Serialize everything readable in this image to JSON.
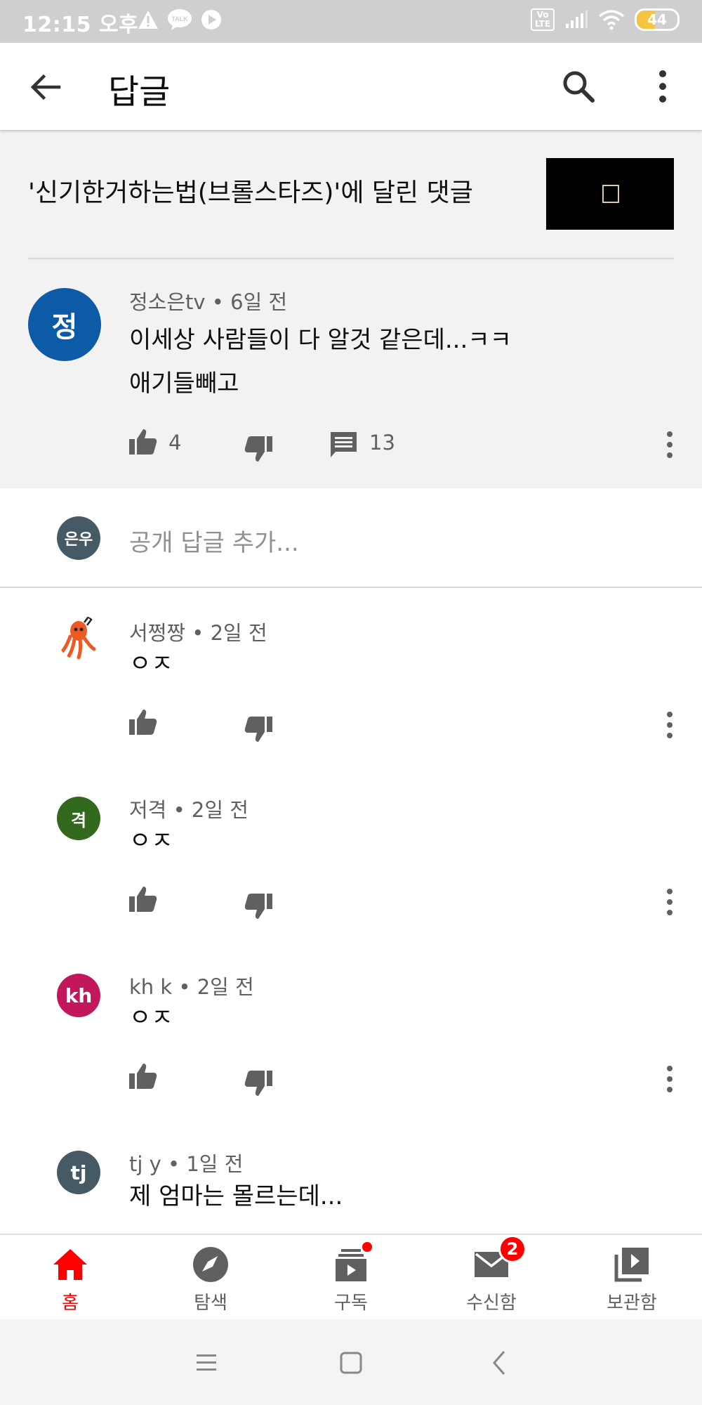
{
  "status_bar": {
    "time": "12:15 오후",
    "battery": "44",
    "battery_level": 0.44,
    "volte_label": "Vo LTE",
    "talk_label": "TALK"
  },
  "app_bar": {
    "title": "답글"
  },
  "video": {
    "title": "'신기한거하는법(브롤스타즈)'에 달린 댓글"
  },
  "parent_comment": {
    "avatar_letter": "정",
    "avatar_color": "#0d5aa7",
    "author": "정소은tv",
    "time": "6일 전",
    "text_line1": "이세상 사람들이 다 알것 같은데...ㅋㅋ",
    "text_line2": "애기들빼고",
    "likes": "4",
    "replies": "13"
  },
  "reply_box": {
    "avatar_letter": "은우",
    "avatar_color": "#455a64",
    "placeholder": "공개 답글 추가..."
  },
  "replies": [
    {
      "author": "서쩡짱",
      "time": "2일 전",
      "text": "ㅇㅈ",
      "avatar_letter": "",
      "avatar_color": "#ffffff",
      "avatar_icon": "octopus-avatar-icon"
    },
    {
      "author": "저격",
      "time": "2일 전",
      "text": "ㅇㅈ",
      "avatar_letter": "격",
      "avatar_color": "#33691e"
    },
    {
      "author": "kh k",
      "time": "2일 전",
      "text": "ㅇㅈ",
      "avatar_letter": "kh",
      "avatar_color": "#c2185b"
    },
    {
      "author": "tj y",
      "time": "1일 전",
      "text": "제 엄마는 몰르는데...",
      "avatar_letter": "tj",
      "avatar_color": "#455a64"
    }
  ],
  "bottom_nav": {
    "items": [
      {
        "label": "홈",
        "icon": "home-icon",
        "active": true
      },
      {
        "label": "탐색",
        "icon": "compass-icon"
      },
      {
        "label": "구독",
        "icon": "subscriptions-icon",
        "dot": true
      },
      {
        "label": "수신함",
        "icon": "inbox-icon",
        "badge": "2"
      },
      {
        "label": "보관함",
        "icon": "library-icon"
      }
    ]
  },
  "colors": {
    "accent": "#ff0000",
    "text_secondary": "#606060",
    "icon_grey": "#909090"
  }
}
